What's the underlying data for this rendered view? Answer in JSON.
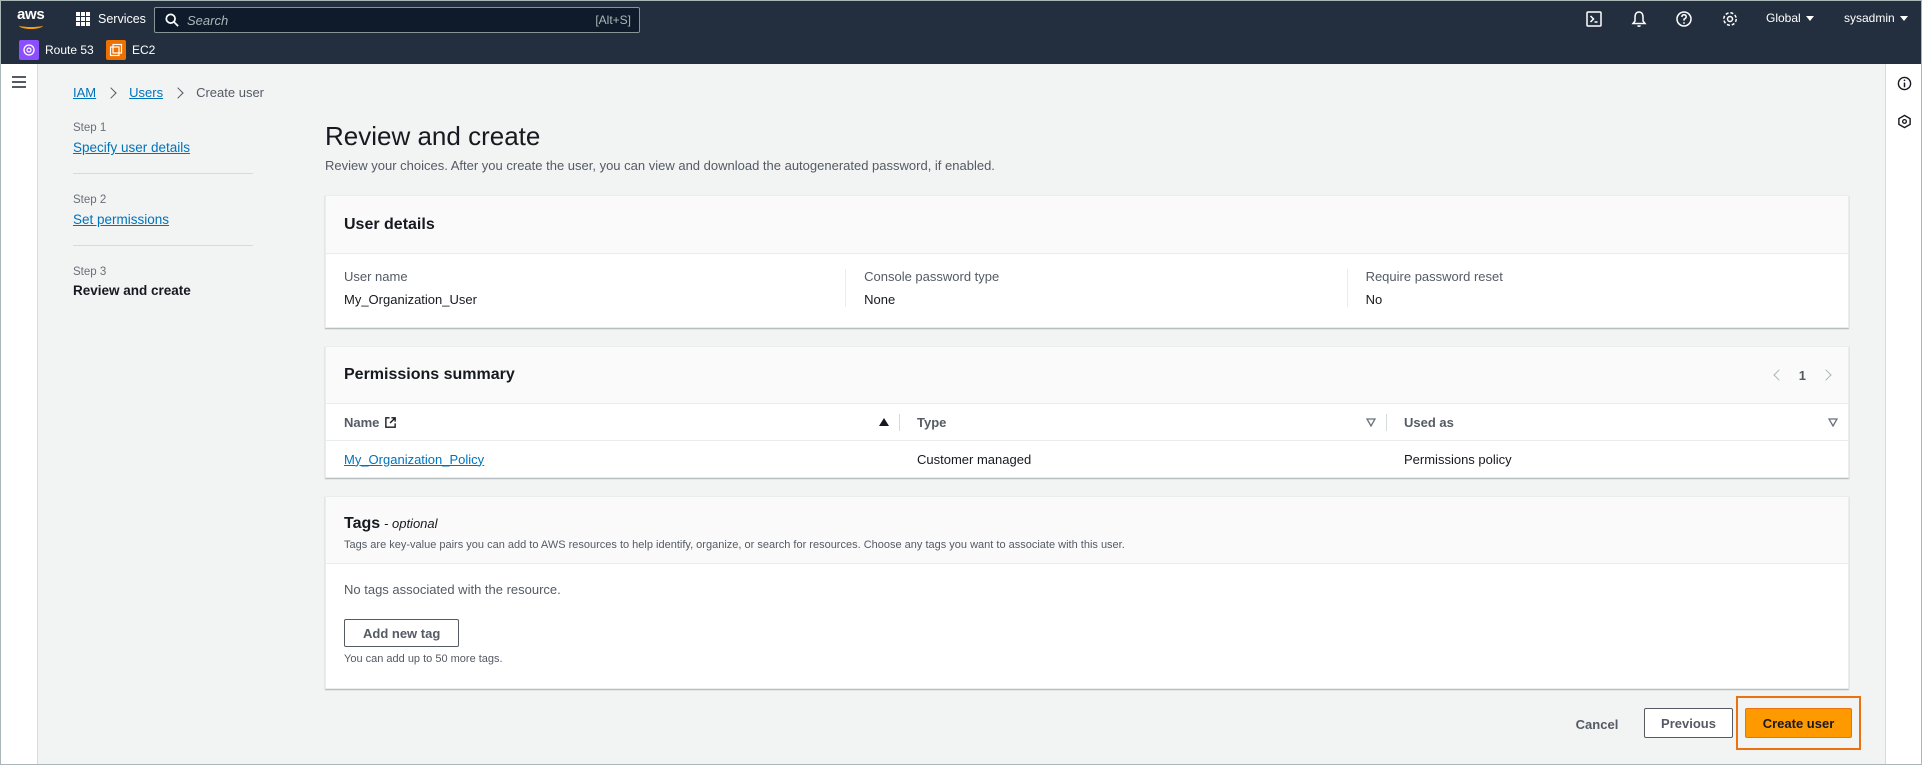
{
  "topnav": {
    "logo": "aws",
    "services_label": "Services",
    "search_placeholder": "Search",
    "search_shortcut": "[Alt+S]",
    "region_label": "Global",
    "user_label": "sysadmin",
    "icons": [
      "cloudshell-icon",
      "bell-icon",
      "help-icon",
      "gear-icon"
    ],
    "favorites": [
      {
        "label": "Route 53",
        "color": "#8c4fff"
      },
      {
        "label": "EC2",
        "color": "#ed7100"
      }
    ]
  },
  "breadcrumb": {
    "items": [
      "IAM",
      "Users",
      "Create user"
    ]
  },
  "steps": [
    {
      "num": "Step 1",
      "label": "Specify user details"
    },
    {
      "num": "Step 2",
      "label": "Set permissions"
    },
    {
      "num": "Step 3",
      "label": "Review and create"
    }
  ],
  "page": {
    "title": "Review and create",
    "description": "Review your choices. After you create the user, you can view and download the autogenerated password, if enabled."
  },
  "user_details": {
    "title": "User details",
    "fields": [
      {
        "label": "User name",
        "value": "My_Organization_User"
      },
      {
        "label": "Console password type",
        "value": "None"
      },
      {
        "label": "Require password reset",
        "value": "No"
      }
    ]
  },
  "permissions": {
    "title": "Permissions summary",
    "page_number": "1",
    "columns": [
      "Name",
      "Type",
      "Used as"
    ],
    "rows": [
      {
        "name": "My_Organization_Policy",
        "type": "Customer managed",
        "used_as": "Permissions policy"
      }
    ]
  },
  "tags": {
    "title": "Tags",
    "optional": "- optional",
    "subtitle": "Tags are key-value pairs you can add to AWS resources to help identify, organize, or search for resources. Choose any tags you want to associate with this user.",
    "empty": "No tags associated with the resource.",
    "add_button": "Add new tag",
    "hint": "You can add up to 50 more tags."
  },
  "actions": {
    "cancel": "Cancel",
    "previous": "Previous",
    "create": "Create user"
  },
  "colors": {
    "nav_bg": "#232f3e",
    "link": "#0073bb",
    "primary": "#ff9900",
    "focus": "#ec7211"
  }
}
